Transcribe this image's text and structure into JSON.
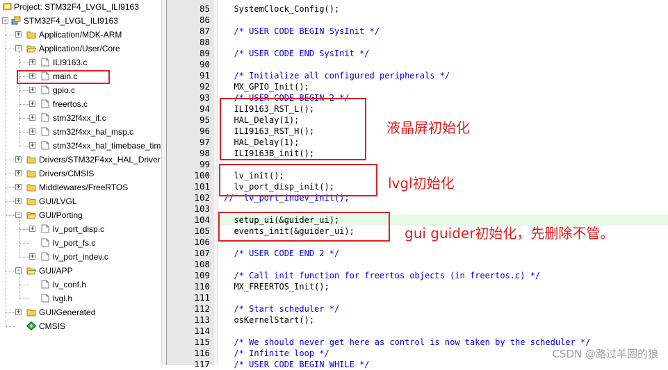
{
  "project": {
    "title": "Project: STM32F4_LVGL_ILI9163",
    "target": "STM32F4_LVGL_ILI9163",
    "tree": [
      {
        "label": "Application/MDK-ARM",
        "type": "folder",
        "level": 1,
        "expander": "+"
      },
      {
        "label": "Application/User/Core",
        "type": "folder-open",
        "level": 1,
        "expander": "-"
      },
      {
        "label": "ILI9163.c",
        "type": "file",
        "level": 2,
        "expander": "+"
      },
      {
        "label": "main.c",
        "type": "file",
        "level": 2,
        "expander": "+"
      },
      {
        "label": "gpio.c",
        "type": "file",
        "level": 2,
        "expander": "+"
      },
      {
        "label": "freertos.c",
        "type": "file",
        "level": 2,
        "expander": "+"
      },
      {
        "label": "stm32f4xx_it.c",
        "type": "file",
        "level": 2,
        "expander": "+"
      },
      {
        "label": "stm32f4xx_hal_msp.c",
        "type": "file",
        "level": 2,
        "expander": "+"
      },
      {
        "label": "stm32f4xx_hal_timebase_tim",
        "type": "file",
        "level": 2,
        "expander": "+"
      },
      {
        "label": "Drivers/STM32F4xx_HAL_Driver",
        "type": "folder",
        "level": 1,
        "expander": "+"
      },
      {
        "label": "Drivers/CMSIS",
        "type": "folder",
        "level": 1,
        "expander": "+"
      },
      {
        "label": "Middlewares/FreeRTOS",
        "type": "folder",
        "level": 1,
        "expander": "+"
      },
      {
        "label": "GUI/LVGL",
        "type": "folder",
        "level": 1,
        "expander": "+"
      },
      {
        "label": "GUI/Porting",
        "type": "folder-open",
        "level": 1,
        "expander": "-"
      },
      {
        "label": "lv_port_disp.c",
        "type": "file",
        "level": 2,
        "expander": "+"
      },
      {
        "label": "lv_port_fs.c",
        "type": "file",
        "level": 2,
        "expander": ""
      },
      {
        "label": "lv_port_indev.c",
        "type": "file",
        "level": 2,
        "expander": "+"
      },
      {
        "label": "GUI/APP",
        "type": "folder-open",
        "level": 1,
        "expander": "-"
      },
      {
        "label": "lv_conf.h",
        "type": "file",
        "level": 2,
        "expander": ""
      },
      {
        "label": "lvgl.h",
        "type": "file",
        "level": 2,
        "expander": ""
      },
      {
        "label": "GUI/Generated",
        "type": "folder",
        "level": 1,
        "expander": "+"
      },
      {
        "label": "CMSIS",
        "type": "cmsis",
        "level": 1,
        "expander": ""
      }
    ]
  },
  "editor": {
    "lines": [
      {
        "n": "85",
        "text": "  SystemClock_Config();",
        "comment": false
      },
      {
        "n": "86",
        "text": "",
        "comment": false
      },
      {
        "n": "87",
        "text": "  /* USER CODE BEGIN SysInit */",
        "comment": true
      },
      {
        "n": "88",
        "text": "",
        "comment": false
      },
      {
        "n": "89",
        "text": "  /* USER CODE END SysInit */",
        "comment": true
      },
      {
        "n": "90",
        "text": "",
        "comment": false
      },
      {
        "n": "91",
        "text": "  /* Initialize all configured peripherals */",
        "comment": true
      },
      {
        "n": "92",
        "text": "  MX_GPIO_Init();",
        "comment": false
      },
      {
        "n": "93",
        "text": "  /* USER CODE BEGIN 2 */",
        "comment": true
      },
      {
        "n": "94",
        "text": "  ILI9163_RST_L();",
        "comment": false
      },
      {
        "n": "95",
        "text": "  HAL_Delay(1);",
        "comment": false
      },
      {
        "n": "96",
        "text": "  ILI9163_RST_H();",
        "comment": false
      },
      {
        "n": "97",
        "text": "  HAL_Delay(1);",
        "comment": false
      },
      {
        "n": "98",
        "text": "  ILI9163B_init();",
        "comment": false
      },
      {
        "n": "99",
        "text": "",
        "comment": false
      },
      {
        "n": "100",
        "text": "  lv_init();",
        "comment": false
      },
      {
        "n": "101",
        "text": "  lv_port_disp_init();",
        "comment": false
      },
      {
        "n": "102",
        "text": "//  lv_port_indev_init();",
        "comment": true
      },
      {
        "n": "103",
        "text": "",
        "comment": false
      },
      {
        "n": "104",
        "text": "  setup_ui(&guider_ui);",
        "comment": false
      },
      {
        "n": "105",
        "text": "  events_init(&guider_ui);",
        "comment": false
      },
      {
        "n": "106",
        "text": "",
        "comment": false
      },
      {
        "n": "107",
        "text": "  /* USER CODE END 2 */",
        "comment": true
      },
      {
        "n": "108",
        "text": "",
        "comment": false
      },
      {
        "n": "109",
        "text": "  /* Call init function for freertos objects (in freertos.c) */",
        "comment": true
      },
      {
        "n": "110",
        "text": "  MX_FREERTOS_Init();",
        "comment": false
      },
      {
        "n": "111",
        "text": "",
        "comment": false
      },
      {
        "n": "112",
        "text": "  /* Start scheduler */",
        "comment": true
      },
      {
        "n": "113",
        "text": "  osKernelStart();",
        "comment": false
      },
      {
        "n": "114",
        "text": "",
        "comment": false
      },
      {
        "n": "115",
        "text": "  /* We should never get here as control is now taken by the scheduler */",
        "comment": true
      },
      {
        "n": "116",
        "text": "  /* Infinite loop */",
        "comment": true
      },
      {
        "n": "117",
        "text": "  /* USER CODE BEGIN WHILE */",
        "comment": true
      }
    ],
    "highlighted_line": "104"
  },
  "annotations": {
    "lcd_init": "液晶屏初始化",
    "lvgl_init": "lvgl初始化",
    "gui_guider_init": "gui guider初始化，先删除不管。"
  },
  "watermark": "CSDN @路过羊圈的狼",
  "colors": {
    "annotation": "#e02020",
    "comment": "#0000e6",
    "highlight": "#e6fbe6"
  }
}
